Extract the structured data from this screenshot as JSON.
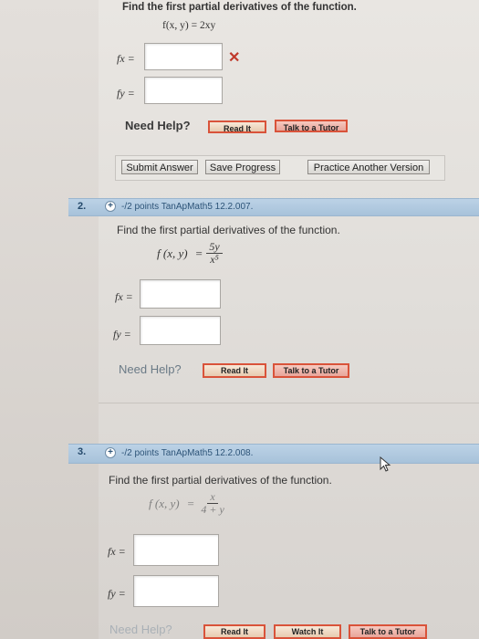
{
  "q1": {
    "instruction": "Find the first partial derivatives of the function.",
    "function": "f(x, y) = 2xy",
    "fx_label": "fx =",
    "fy_label": "fy =",
    "incorrect_mark": "✕",
    "need_help": "Need Help?",
    "read_it": "Read It",
    "talk_tutor": "Talk to a Tutor",
    "submit": "Submit Answer",
    "save": "Save Progress",
    "practice": "Practice Another Version"
  },
  "q2": {
    "number": "2.",
    "meta": "-/2 points TanApMath5 12.2.007.",
    "instruction": "Find the first partial derivatives of the function.",
    "lhs": "f (x, y)",
    "eq": "=",
    "numerator": "5y",
    "denominator": "x⁵",
    "fx_label": "fx =",
    "fy_label": "fy =",
    "need_help": "Need Help?",
    "read_it": "Read It",
    "talk_tutor": "Talk to a Tutor"
  },
  "q3": {
    "number": "3.",
    "meta": "-/2 points TanApMath5 12.2.008.",
    "instruction": "Find the first partial derivatives of the function.",
    "lhs": "f (x, y)",
    "eq": "=",
    "numerator": "x",
    "denominator": "4 + y",
    "fx_label": "fx =",
    "fy_label": "fy =",
    "need_help": "Need Help?",
    "read_it": "Read It",
    "watch_it": "Watch It",
    "talk_tutor": "Talk to a Tutor"
  },
  "icons": {
    "plus": "+",
    "cursor": "mouse-pointer-icon"
  }
}
